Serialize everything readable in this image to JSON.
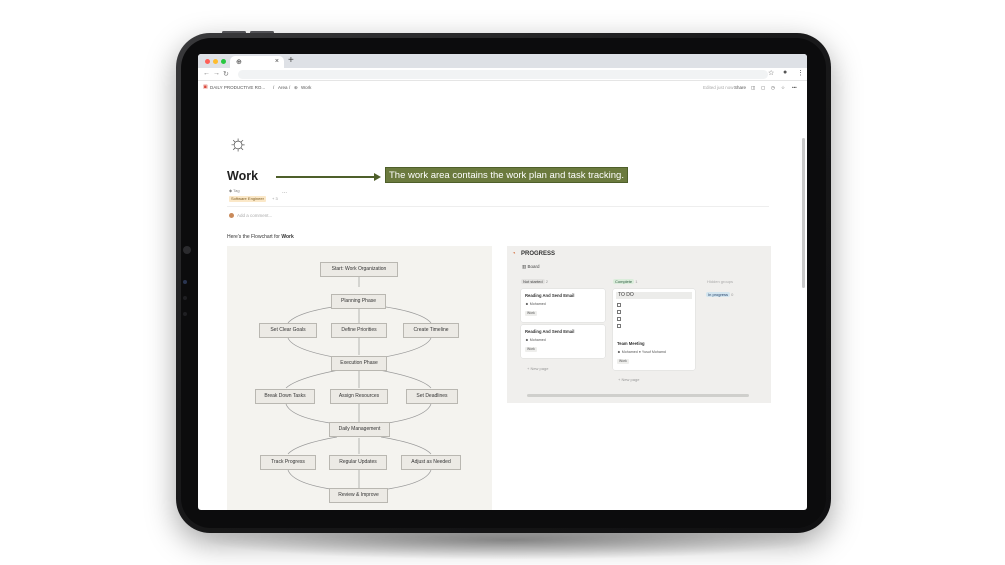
{
  "browser": {
    "tab_icon": "notion-icon",
    "new_tab": "+",
    "tab_close": "×"
  },
  "topbar": {
    "breadcrumb": [
      "DAILY PRODUCTIVE RO...",
      "/",
      "Area",
      "/",
      "Work"
    ],
    "edited": "Edited just now",
    "share": "Share"
  },
  "page": {
    "title": "Work",
    "property_label": "Tag",
    "tag_chip": "Software Engineer",
    "tag_extra": "+ 3",
    "more": "...",
    "comment_placeholder": "Add a comment...",
    "intro_prefix": "Here's the Flowchart for ",
    "intro_bold": "Work"
  },
  "annotation": {
    "text": "The work area contains the work plan and task tracking.",
    "color": "#6b7a3e"
  },
  "flowchart": {
    "nodes": {
      "start": "Start: Work Organization",
      "planning": "Planning Phase",
      "goals": "Set Clear Goals",
      "priorities": "Define Priorities",
      "timeline": "Create Timeline",
      "execution": "Execution Phase",
      "breakdown": "Break Down Tasks",
      "resources": "Assign Resources",
      "deadlines": "Set Deadlines",
      "daily": "Daily Management",
      "track": "Track Progress",
      "updates": "Regular Updates",
      "adjust": "Adjust as Needed",
      "review": "Review & Improve"
    }
  },
  "progress": {
    "title": "PROGRESS",
    "view": "Board",
    "columns": {
      "not_started": {
        "label": "Not started",
        "count": "2"
      },
      "complete": {
        "label": "Complete",
        "count": "1"
      },
      "hidden": {
        "label": "Hidden groups"
      },
      "in_progress": {
        "label": "In progress",
        "count": "0"
      }
    },
    "cards": {
      "c1": {
        "title": "Reading And Send Email",
        "person": "Mohamed",
        "tag": "Work"
      },
      "c2": {
        "title": "Reading And Send Email",
        "person": "Mohamed",
        "tag": "Work"
      },
      "c3": {
        "todo": "TO DO",
        "title": "Team Meeting",
        "person": "Mohamed",
        "person2": "Yusuf Mohamd",
        "tag": "Work"
      }
    },
    "new_page": "+ New page"
  }
}
